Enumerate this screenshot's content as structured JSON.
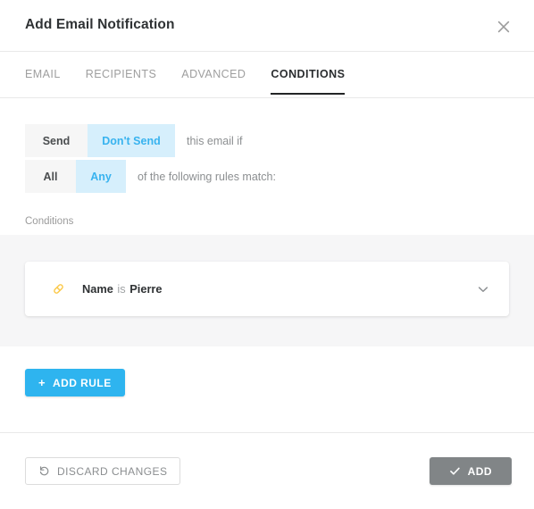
{
  "dialog": {
    "title": "Add Email Notification",
    "close_icon": "close-icon"
  },
  "tabs": [
    {
      "label": "EMAIL",
      "active": false
    },
    {
      "label": "RECIPIENTS",
      "active": false
    },
    {
      "label": "ADVANCED",
      "active": false
    },
    {
      "label": "CONDITIONS",
      "active": true
    }
  ],
  "toggles": {
    "send_row": {
      "option_off": "Send",
      "option_on": "Don't Send",
      "selected": "Don't Send",
      "caption": "this email if"
    },
    "match_row": {
      "option_off": "All",
      "option_on": "Any",
      "selected": "Any",
      "caption": "of the following rules match:"
    }
  },
  "conditions": {
    "section_label": "Conditions",
    "rules": [
      {
        "icon": "link-icon",
        "field": "Name",
        "operator": "is",
        "value": "Pierre",
        "expand_icon": "chevron-down-icon"
      }
    ],
    "add_rule_label": "ADD RULE",
    "add_rule_plus": "+"
  },
  "footer": {
    "discard_label": "DISCARD CHANGES",
    "discard_icon": "undo-icon",
    "submit_label": "ADD",
    "submit_icon": "check-icon"
  },
  "colors": {
    "accent": "#2eb4ef",
    "accent_soft_bg": "#d6effc",
    "accent_text": "#38b3ef",
    "panel_bg": "#f6f6f7",
    "segment_off_bg": "#f6f6f6",
    "link_icon": "#fbc94b",
    "submit_disabled_bg": "#818587",
    "tab_underline": "#232526"
  }
}
